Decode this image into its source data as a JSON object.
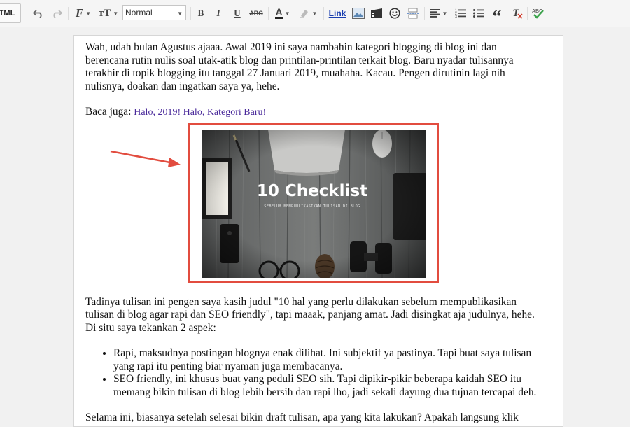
{
  "toolbar": {
    "html_label": "TML",
    "font_size_value": "Normal",
    "link_label": "Link",
    "bold_label": "B",
    "italic_label": "I",
    "underline_label": "U",
    "strike_label": "ABC",
    "text_color_label": "A",
    "clear_format_label": "T"
  },
  "post": {
    "p1": "Wah, udah bulan Agustus ajaaa. Awal 2019 ini saya nambahin kategori blogging di blog ini dan berencana rutin nulis soal utak-atik blog dan printilan-printilan terkait blog. Baru nyadar tulisannya terakhir di topik blogging itu tanggal 27 Januari 2019, muahaha. Kacau. Pengen dirutinin lagi nih nulisnya, doakan dan ingatkan saya ya, hehe.",
    "read_also_prefix": "Baca juga: ",
    "read_also_link": "Halo, 2019! Halo, Kategori Baru!",
    "image_title": "10 Checklist",
    "image_subtitle": "SEBELUM MEMPUBLIKASIKAN TULISAN DI BLOG",
    "p2": "Tadinya tulisan ini pengen saya kasih judul \"10 hal yang perlu dilakukan sebelum mempublikasikan tulisan di blog agar rapi dan SEO friendly\", tapi maaak, panjang amat. Jadi disingkat aja judulnya, hehe. Di situ saya tekankan 2 aspek:",
    "bullets": [
      "Rapi, maksudnya postingan blognya enak dilihat. Ini subjektif ya pastinya. Tapi buat saya tulisan yang rapi itu penting biar nyaman juga membacanya.",
      "SEO friendly, ini khusus buat yang peduli SEO sih. Tapi dipikir-pikir beberapa kaidah SEO itu memang bikin tulisan di blog lebih bersih dan rapi lho, jadi sekali dayung dua tujuan tercapai deh."
    ],
    "p3": "Selama ini, biasanya setelah selesai bikin draft tulisan, apa yang kita lakukan? Apakah langsung klik"
  },
  "colors": {
    "highlight_border": "#e24c3f",
    "arrow": "#e24c3f",
    "link": "#4a2a9a",
    "check_icon": "#3aa34a"
  }
}
